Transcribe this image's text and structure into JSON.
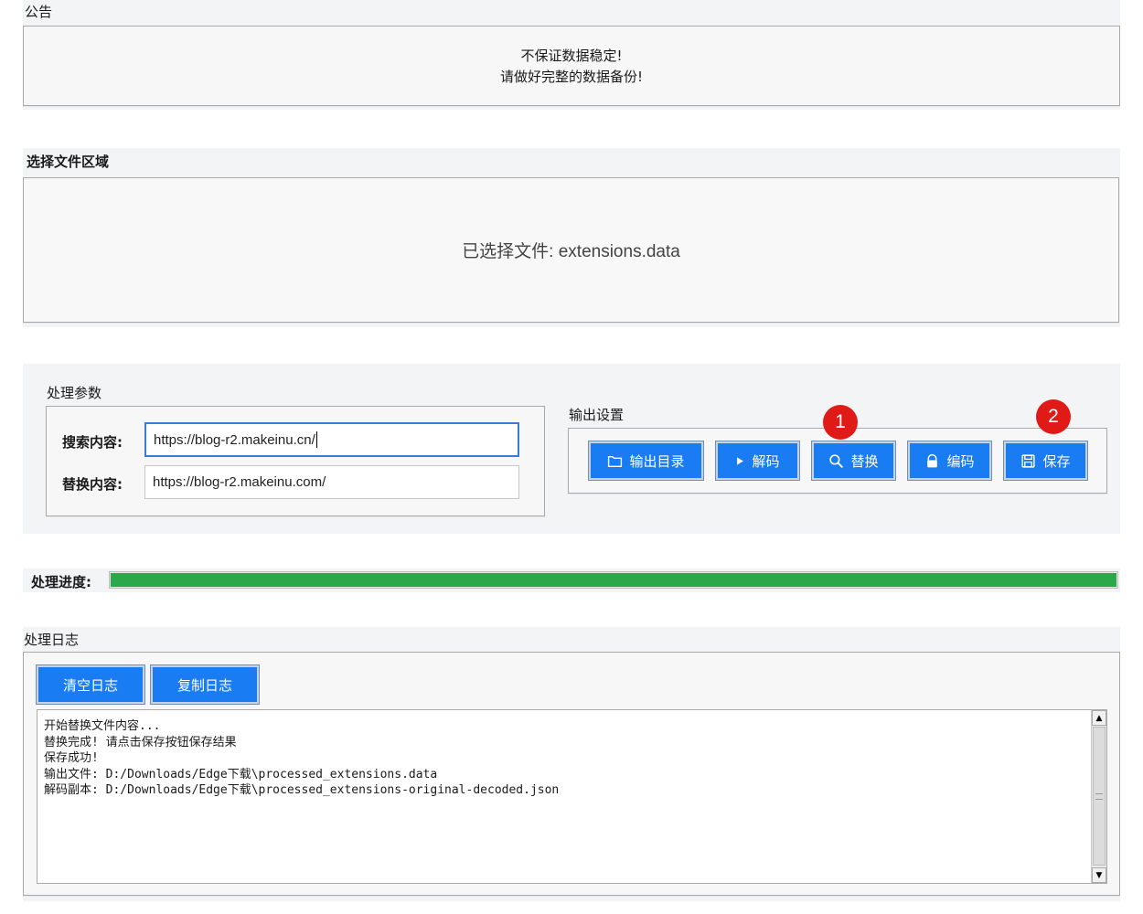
{
  "notice": {
    "title": "公告",
    "lines": [
      "不保证数据稳定!",
      "请做好完整的数据备份!"
    ]
  },
  "file_area": {
    "title": "选择文件区域",
    "selected_text": "已选择文件: extensions.data"
  },
  "params": {
    "title": "处理参数",
    "search_label": "搜索内容:",
    "search_value": "https://blog-r2.makeinu.cn/",
    "replace_label": "替换内容:",
    "replace_value": "https://blog-r2.makeinu.com/"
  },
  "output": {
    "title": "输出设置",
    "buttons": {
      "output_dir": "输出目录",
      "decode": "解码",
      "replace": "替换",
      "encode": "编码",
      "save": "保存"
    },
    "badges": [
      "1",
      "2"
    ]
  },
  "progress": {
    "label": "处理进度:",
    "value": 1.0,
    "color": "#2aa84a"
  },
  "log": {
    "title": "处理日志",
    "clear_button": "清空日志",
    "copy_button": "复制日志",
    "lines": [
      "开始替换文件内容...",
      "替换完成! 请点击保存按钮保存结果",
      "保存成功!",
      "输出文件: D:/Downloads/Edge下载\\processed_extensions.data",
      "解码副本: D:/Downloads/Edge下载\\processed_extensions-original-decoded.json"
    ]
  },
  "colors": {
    "button": "#1a7cf2",
    "badge": "#e01b17",
    "panel": "#f3f4f6"
  }
}
